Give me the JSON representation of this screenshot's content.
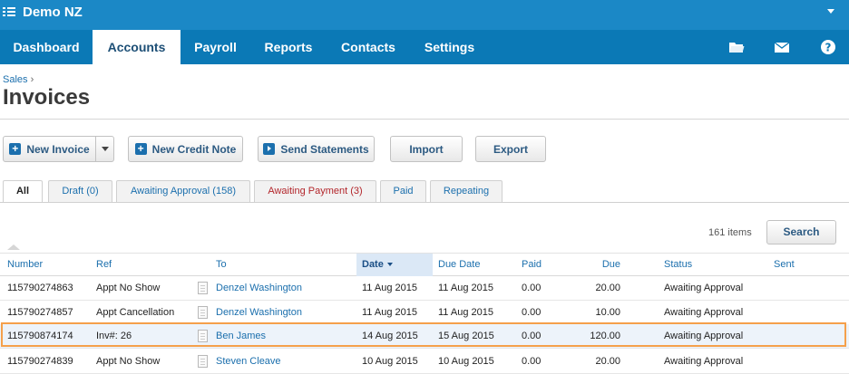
{
  "org_name": "Demo NZ",
  "nav": {
    "tabs": [
      "Dashboard",
      "Accounts",
      "Payroll",
      "Reports",
      "Contacts",
      "Settings"
    ],
    "active": "Accounts",
    "icons": [
      "folder-icon",
      "mail-icon",
      "help-icon"
    ]
  },
  "breadcrumb": {
    "parent": "Sales",
    "separator": "›"
  },
  "page_title": "Invoices",
  "toolbar": {
    "new_invoice": "New Invoice",
    "new_credit_note": "New Credit Note",
    "send_statements": "Send Statements",
    "import": "Import",
    "export": "Export"
  },
  "filter_tabs": [
    "All",
    "Draft (0)",
    "Awaiting Approval (158)",
    "Awaiting Payment (3)",
    "Paid",
    "Repeating"
  ],
  "items_count": "161 items",
  "search_label": "Search",
  "columns": [
    "Number",
    "Ref",
    "To",
    "Date",
    "Due Date",
    "Paid",
    "Due",
    "Status",
    "Sent"
  ],
  "rows": [
    {
      "number": "115790274863",
      "ref": "Appt No Show",
      "to": "Denzel Washington",
      "date": "11 Aug 2015",
      "due_date": "11 Aug 2015",
      "paid": "0.00",
      "due": "20.00",
      "status": "Awaiting Approval",
      "sent": ""
    },
    {
      "number": "115790274857",
      "ref": "Appt Cancellation",
      "to": "Denzel Washington",
      "date": "11 Aug 2015",
      "due_date": "11 Aug 2015",
      "paid": "0.00",
      "due": "10.00",
      "status": "Awaiting Approval",
      "sent": ""
    },
    {
      "number": "115790874174",
      "ref": "Inv#: 26",
      "to": "Ben James",
      "date": "14 Aug 2015",
      "due_date": "15 Aug 2015",
      "paid": "0.00",
      "due": "120.00",
      "status": "Awaiting Approval",
      "sent": ""
    },
    {
      "number": "115790274839",
      "ref": "Appt No Show",
      "to": "Steven Cleave",
      "date": "10 Aug 2015",
      "due_date": "10 Aug 2015",
      "paid": "0.00",
      "due": "20.00",
      "status": "Awaiting Approval",
      "sent": ""
    }
  ],
  "colors": {
    "topbar": "#1b88c6",
    "nav": "#0b79b6",
    "link": "#1b6fad",
    "selection": "#f5a04b",
    "warning_tab": "#b3262b"
  }
}
